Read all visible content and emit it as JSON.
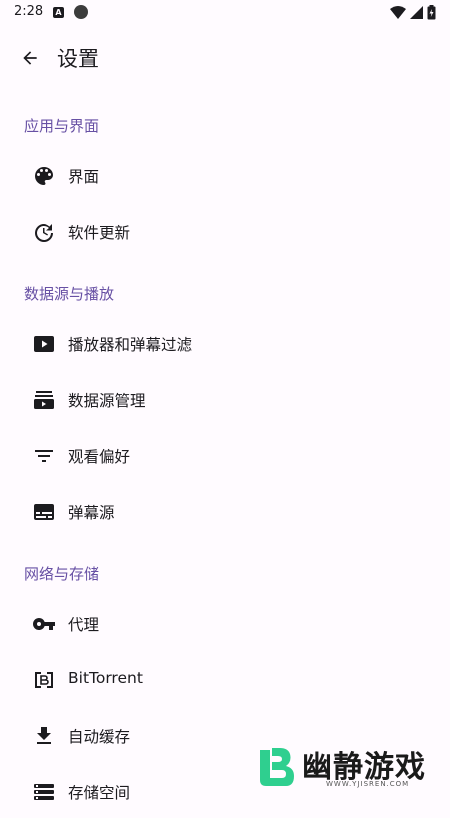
{
  "status_bar": {
    "time": "2:28",
    "a_badge": "A"
  },
  "header": {
    "title": "设置"
  },
  "sections": [
    {
      "title": "应用与界面",
      "items": [
        {
          "label": "界面",
          "icon": "palette-icon"
        },
        {
          "label": "软件更新",
          "icon": "update-icon"
        }
      ]
    },
    {
      "title": "数据源与播放",
      "items": [
        {
          "label": "播放器和弹幕过滤",
          "icon": "play-box-icon"
        },
        {
          "label": "数据源管理",
          "icon": "subscriptions-icon"
        },
        {
          "label": "观看偏好",
          "icon": "filter-icon"
        },
        {
          "label": "弹幕源",
          "icon": "subtitles-icon"
        }
      ]
    },
    {
      "title": "网络与存储",
      "items": [
        {
          "label": "代理",
          "icon": "key-icon"
        },
        {
          "label": "BitTorrent",
          "icon": "bittorrent-icon"
        },
        {
          "label": "自动缓存",
          "icon": "download-icon"
        },
        {
          "label": "存储空间",
          "icon": "storage-icon"
        }
      ]
    }
  ],
  "watermark": {
    "name": "幽静游戏",
    "url": "WWW.YJISREN.COM"
  },
  "colors": {
    "accent": "#6750a4",
    "background": "#fffbff",
    "text": "#1c1b1f",
    "icon": "#1c1b1f"
  }
}
